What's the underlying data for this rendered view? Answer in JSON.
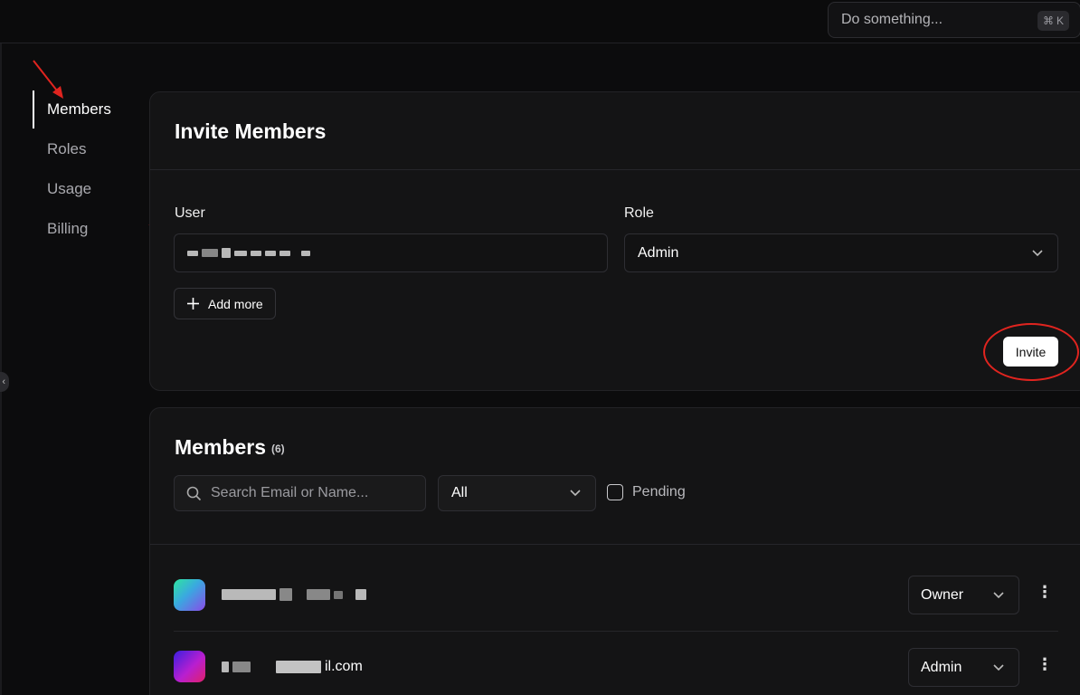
{
  "topbar": {
    "command_placeholder": "Do something...",
    "shortcut_symbol": "⌘",
    "shortcut_key": "K"
  },
  "sidebar": {
    "items": [
      {
        "label": "Members",
        "active": true
      },
      {
        "label": "Roles",
        "active": false
      },
      {
        "label": "Usage",
        "active": false
      },
      {
        "label": "Billing",
        "active": false
      }
    ]
  },
  "invite": {
    "title": "Invite Members",
    "user_label": "User",
    "role_label": "Role",
    "role_value": "Admin",
    "add_more_label": "Add more",
    "invite_button": "Invite"
  },
  "members": {
    "title": "Members",
    "count": "(6)",
    "search_placeholder": "Search Email or Name...",
    "filter_value": "All",
    "pending_label": "Pending",
    "rows": [
      {
        "email_suffix": "",
        "role": "Owner"
      },
      {
        "email_suffix": "il.com",
        "role": "Admin"
      }
    ]
  },
  "colors": {
    "accent": "#ffffff",
    "annotation": "#e0241f",
    "background": "#0c0c0d",
    "card": "#141415"
  }
}
